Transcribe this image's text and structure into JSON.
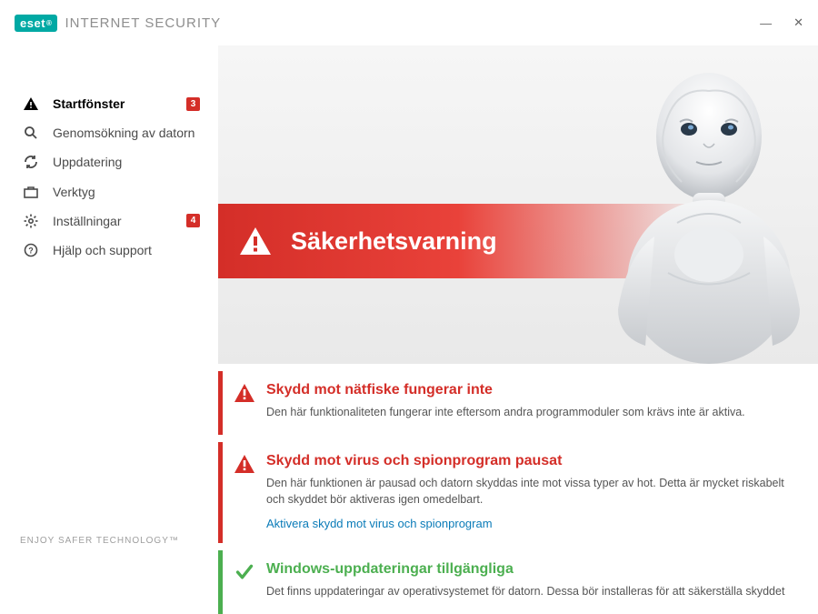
{
  "titlebar": {
    "brand_badge": "eset",
    "brand_text": "INTERNET SECURITY"
  },
  "sidebar": {
    "items": [
      {
        "label": "Startfönster",
        "badge": "3"
      },
      {
        "label": "Genomsökning av datorn"
      },
      {
        "label": "Uppdatering"
      },
      {
        "label": "Verktyg"
      },
      {
        "label": "Inställningar",
        "badge": "4"
      },
      {
        "label": "Hjälp och support"
      }
    ],
    "footer": "ENJOY SAFER TECHNOLOGY™"
  },
  "banner": {
    "title": "Säkerhetsvarning"
  },
  "alerts": [
    {
      "title": "Skydd mot nätfiske fungerar inte",
      "text": "Den här funktionaliteten fungerar inte eftersom andra programmoduler som krävs inte är aktiva."
    },
    {
      "title": "Skydd mot virus och spionprogram pausat",
      "text": "Den här funktionen är pausad och datorn skyddas inte mot vissa typer av hot. Detta är mycket riskabelt och skyddet bör aktiveras igen omedelbart.",
      "link": "Aktivera skydd mot virus och spionprogram"
    },
    {
      "title": "Windows-uppdateringar tillgängliga",
      "text": "Det finns uppdateringar av operativsystemet för datorn. Dessa bör installeras för att säkerställa skyddet"
    }
  ]
}
